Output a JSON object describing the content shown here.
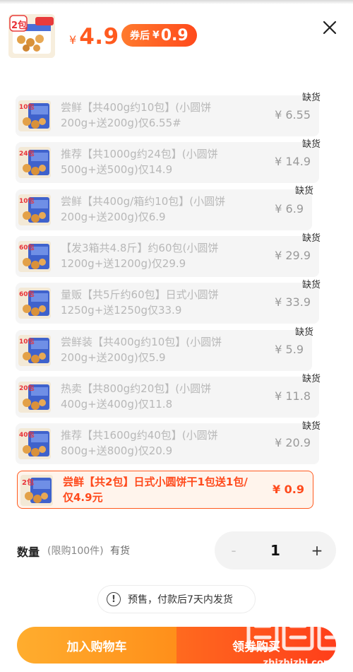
{
  "header": {
    "thumb_badge": "2包",
    "currency": "¥",
    "price": "4.9",
    "coupon_label": "券后",
    "coupon_currency": "¥",
    "coupon_price": "0.9"
  },
  "options": [
    {
      "badge": "10包",
      "title": "尝鲜【共400g约10包】(小圆饼\n200g+送200g)仅6.55#",
      "price": "¥ 6.55",
      "stock": "缺货"
    },
    {
      "badge": "24包",
      "title": "推荐【共1000g约24包】(小圆饼\n500g+送500g)仅14.9",
      "price": "¥ 14.9",
      "stock": "缺货"
    },
    {
      "badge": "10包",
      "title": "尝鲜【共400g/箱约10包】(小圆饼\n200g+送200g)仅6.9",
      "price": "¥ 6.9",
      "stock": "缺货"
    },
    {
      "badge": "60包",
      "title": "【发3箱共4.8斤】约60包(小圆饼\n1200g+送1200g)仅29.9",
      "price": "¥ 29.9",
      "stock": "缺货"
    },
    {
      "badge": "60包",
      "title": "量贩【共5斤约60包】日式小圆饼\n1250g+送1250g仅33.9",
      "price": "¥ 33.9",
      "stock": "缺货"
    },
    {
      "badge": "10包",
      "title": "尝鲜装【共400g约10包】(小圆饼\n200g+送200g)仅5.9",
      "price": "¥ 5.9",
      "stock": "缺货"
    },
    {
      "badge": "20包",
      "title": "热卖【共800g约20包】(小圆饼\n400g+送400g)仅11.8",
      "price": "¥ 11.8",
      "stock": "缺货"
    },
    {
      "badge": "40包",
      "title": "推荐【共1600g约40包】(小圆饼\n800g+送800g)仅20.9",
      "price": "¥ 20.9",
      "stock": "缺货"
    }
  ],
  "selected_option": {
    "badge": "2包",
    "title": "尝鲜【共2包】日式小圆饼干1包送1包/\n仅4.9元",
    "price": "¥ 0.9"
  },
  "quantity": {
    "label": "数量",
    "limit": "(限购100件)",
    "stock": "有货",
    "minus": "-",
    "value": "1",
    "plus": "+"
  },
  "notice": {
    "icon_glyph": "!",
    "text": "预售，付款后7天内发货"
  },
  "actions": {
    "add_to_cart": "加入购物车",
    "buy_now": "领券购买"
  },
  "watermark": "值 什么值得买",
  "colors": {
    "accent": "#ff5a1f",
    "selected_bg": "#fff4ec",
    "cart_button": "#ffa126",
    "buy_button": "#ff4e1c"
  }
}
